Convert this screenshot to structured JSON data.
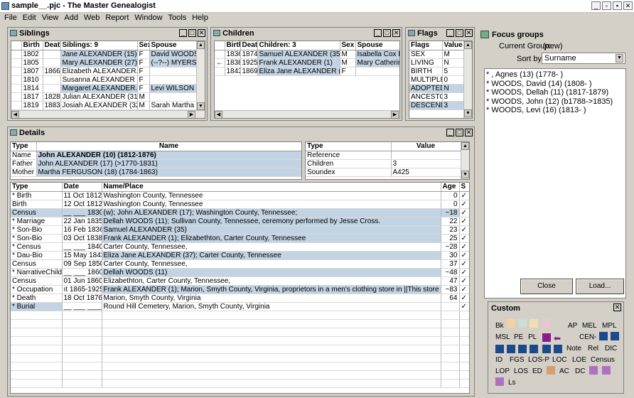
{
  "window": {
    "title": "sample__.pjc - The Master Genealogist"
  },
  "menu": [
    "File",
    "Edit",
    "View",
    "Add",
    "Web",
    "Report",
    "Window",
    "Tools",
    "Help"
  ],
  "siblings": {
    "title": "Siblings",
    "headers": [
      "",
      "Birth",
      "Death",
      "Siblings: 9",
      "Sex",
      "Spouse"
    ],
    "rows": [
      [
        "",
        "1802",
        "",
        "Jane ALEXANDER (15)",
        "F",
        "David WOODS (1"
      ],
      [
        "",
        "1805",
        "",
        "Mary ALEXANDER (27)",
        "F",
        "(--?--) MYERS ("
      ],
      [
        "",
        "1807",
        "1866",
        "Elizabeth ALEXANDER...",
        "F",
        ""
      ],
      [
        "",
        "1810",
        "",
        "Susanna ALEXANDER (...",
        "F",
        ""
      ],
      [
        "",
        "1814",
        "",
        "Margaret ALEXANDER...",
        "F",
        "Levi WILSON (5"
      ],
      [
        "",
        "1817",
        "1828",
        "Julian ALEXANDER (31)",
        "M",
        ""
      ],
      [
        "",
        "1819",
        "1883",
        "Josiah ALEXANDER (32)",
        "M",
        "Sarah Martha B"
      ]
    ]
  },
  "children": {
    "title": "Children",
    "headers": [
      "",
      "Birth",
      "Death",
      "Children: 3",
      "Sex",
      "Spouse"
    ],
    "rows": [
      [
        "",
        "1836",
        "1874",
        "Samuel ALEXANDER (35)",
        "M",
        "Isabella Cox RO"
      ],
      [
        "←",
        "1838",
        "1925",
        "Frank ALEXANDER (1)",
        "M",
        "Mary Catherine"
      ],
      [
        "",
        "1843",
        "1869",
        "Eliza Jane ALEXANDER (37)",
        "F",
        ""
      ]
    ]
  },
  "flags": {
    "title": "Flags",
    "headers": [
      "Flags",
      "Value"
    ],
    "rows": [
      [
        "SEX",
        "M"
      ],
      [
        "LIVING",
        "N"
      ],
      [
        "BIRTH",
        "5"
      ],
      [
        "MULTIPLE",
        "0"
      ],
      [
        "ADOPTED",
        "N"
      ],
      [
        "ANCESTOR",
        "3"
      ],
      [
        "DESCENDA",
        "3"
      ]
    ]
  },
  "focus": {
    "title": "Focus groups",
    "current_label": "Current Group:",
    "current_value": "(new)",
    "sort_label": "Sort by:",
    "sort_value": "Surname",
    "items": [
      "* , Agnes (13) (1778-  )",
      "* WOODS, David (14) (1808-  )",
      "* WOODS, Dellah (11) (1817-1879)",
      "* WOODS, John (12) (b1788->1835)",
      "* WOODS, Levi (16) (1813-  )"
    ],
    "close": "Close",
    "load": "Load..."
  },
  "details": {
    "title": "Details",
    "type_header": "Type",
    "name_header": "Name",
    "people": [
      [
        "Name",
        "John ALEXANDER (10)  (1812-1876)"
      ],
      [
        "Father",
        "John ALEXANDER (17)  (>1770-1831)"
      ],
      [
        "Mother",
        "Martha FERGUSON (18)  (1784-1863)"
      ]
    ],
    "ref_headers": [
      "Type",
      "Value"
    ],
    "refs": [
      [
        "Reference",
        ""
      ],
      [
        "Children",
        "3"
      ],
      [
        "Soundex",
        "A425"
      ]
    ],
    "event_headers": [
      "Type",
      "Date",
      "Name/Place",
      "Age",
      "S"
    ],
    "events": [
      [
        "* Birth",
        "11 Oct 1812",
        "Washington County, Tennessee",
        "0",
        "✓"
      ],
      [
        "Birth",
        "12 Oct 1812",
        "Washington County, Tennessee",
        "0",
        "✓"
      ],
      [
        "Census",
        "__ ___ 1830",
        "(w); John ALEXANDER (17); Washington County, Tennessee;",
        "~18",
        "✓"
      ],
      [
        "* Marriage",
        "22 Jan 1835",
        "Dellah WOODS (11); Sullivan County, Tennessee, ceremony performed by Jesse Cross.",
        "22",
        "✓"
      ],
      [
        "* Son-Bio",
        "16 Feb 1836",
        "Samuel ALEXANDER (35)",
        "23",
        "✓"
      ],
      [
        "* Son-Bio",
        "03 Oct 1838",
        "Frank ALEXANDER (1); Elizabethton, Carter County, Tennessee",
        "25",
        "✓"
      ],
      [
        "* Census",
        "__ ___ 1840",
        "Carter County, Tennessee,",
        "~28",
        "✓"
      ],
      [
        "* Dau-Bio",
        "15 May 1843",
        "Eliza Jane ALEXANDER (37); Carter County, Tennessee",
        "30",
        "✓"
      ],
      [
        "Census",
        "09 Sep 1850",
        "Carter County, Tennessee,",
        "37",
        "✓"
      ],
      [
        "* NarrativeChildren",
        "__ ___ 1860",
        "Dellah WOODS (11)",
        "~48",
        "✓"
      ],
      [
        "Census",
        "01 Jun 1860",
        "Elizabethton, Carter County, Tennessee,",
        "47",
        "✓"
      ],
      [
        "* Occupation",
        "ıt 1865-1925",
        "Frank ALEXANDER (1); Marion, Smyth County, Virginia, proprietors in a men's clothing store in ||This store",
        "~83",
        "✓"
      ],
      [
        "* Death",
        "18 Oct 1876",
        "Marion, Smyth County, Virginia",
        "64",
        "✓"
      ],
      [
        "* Burial",
        "__ ___ ____",
        "Round Hill Cemetery, Marion, Smyth County, Virginia",
        "",
        "✓"
      ]
    ]
  },
  "custom": {
    "title": "Custom",
    "labels": [
      "Bk",
      "AP",
      "MEL",
      "MPL",
      "MSL",
      "PE",
      "PL",
      "CEN-",
      "Note",
      "Rel",
      "DIC",
      "ID",
      "FGS",
      "LOS-P",
      "LOC",
      "LOE",
      "Census",
      "LOP",
      "LOS",
      "ED",
      "AC",
      "DC",
      "Ls"
    ]
  }
}
